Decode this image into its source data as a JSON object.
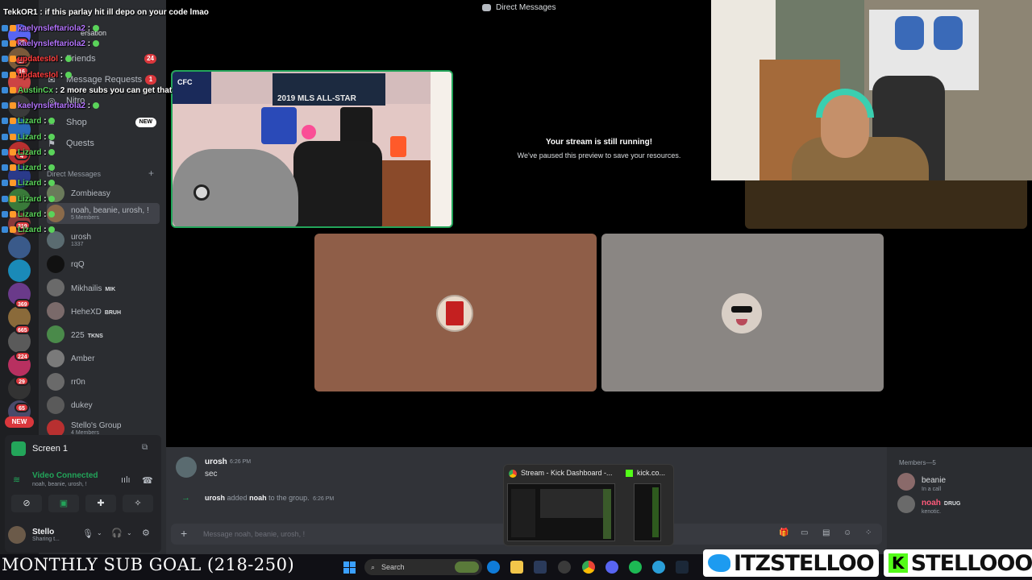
{
  "overlay_chat": [
    {
      "user": "TekkOR1",
      "color": "#ffffff",
      "text": "if this parlay hit ill depo on your code lmao"
    },
    {
      "user": "kaelynsleftariola2",
      "color": "#b575ff",
      "text": ""
    },
    {
      "user": "kaelynsleftariola2",
      "color": "#b575ff",
      "text": ""
    },
    {
      "user": "updatesIol",
      "color": "#ff3c3c",
      "text": ""
    },
    {
      "user": "updatesIol",
      "color": "#ff3c3c",
      "text": ""
    },
    {
      "user": "AustinCx",
      "color": "#5ad35a",
      "text": "2 more subs you can get that"
    },
    {
      "user": "kaelynsleftariola2",
      "color": "#b575ff",
      "text": ""
    },
    {
      "user": "Lizard",
      "color": "#5ad35a",
      "text": ""
    },
    {
      "user": "Lizard",
      "color": "#5ad35a",
      "text": ""
    },
    {
      "user": "Lizard",
      "color": "#5ad35a",
      "text": ""
    },
    {
      "user": "Lizard",
      "color": "#5ad35a",
      "text": ""
    },
    {
      "user": "Lizard",
      "color": "#5ad35a",
      "text": ""
    },
    {
      "user": "Lizard",
      "color": "#5ad35a",
      "text": ""
    },
    {
      "user": "Lizard",
      "color": "#5ad35a",
      "text": ""
    },
    {
      "user": "Lizard",
      "color": "#5ad35a",
      "text": ""
    }
  ],
  "server_badges": [
    "25",
    "18",
    "16",
    "4",
    "319",
    "369",
    "665",
    "224",
    "29",
    "65"
  ],
  "server_new": "NEW",
  "sidebar": {
    "items": [
      {
        "label": "Find or start a conversation",
        "visible_fragment": "ersation"
      },
      {
        "label": "Friends",
        "badge": "24"
      },
      {
        "label": "Message Requests",
        "badge": "1"
      },
      {
        "label": "Nitro"
      },
      {
        "label": "Shop",
        "badge_new": "NEW"
      },
      {
        "label": "Quests"
      }
    ],
    "dm_header": "Direct Messages",
    "dm_plus": "+",
    "dms": [
      {
        "name": "Zombieasy",
        "sub": "",
        "tag": "",
        "color": "#6a7a5a"
      },
      {
        "name": "noah, beanie, urosh, !",
        "sub": "5 Members",
        "tag": "",
        "color": "#8a6a4a"
      },
      {
        "name": "urosh",
        "sub": "1337",
        "tag": "",
        "color": "#5a6b70"
      },
      {
        "name": "rqQ",
        "sub": "",
        "tag": "",
        "color": "#111111"
      },
      {
        "name": "Mikhailis",
        "sub": "",
        "tag": "MIK",
        "color": "#6a6a6a"
      },
      {
        "name": "HeheXD",
        "sub": "",
        "tag": "BRUH",
        "color": "#7a6a6a"
      },
      {
        "name": "225",
        "sub": "",
        "tag": "TKNS",
        "color": "#4a8a4a"
      },
      {
        "name": "Amber",
        "sub": "",
        "tag": "",
        "color": "#7a7a7a"
      },
      {
        "name": "rr0n",
        "sub": "",
        "tag": "",
        "color": "#6a6a6a"
      },
      {
        "name": "dukey",
        "sub": "",
        "tag": "",
        "color": "#5a5a5a"
      },
      {
        "name": "Stello's Group",
        "sub": "4 Members",
        "tag": "",
        "color": "#b83030"
      }
    ]
  },
  "voice": {
    "screen_label": "Screen 1",
    "status": "Video Connected",
    "status_sub": "noah, beanie, urosh, !"
  },
  "user_panel": {
    "name": "Stello",
    "status": "Sharing t..."
  },
  "main": {
    "title": "Direct Messages",
    "paused_title": "Your stream is still running!",
    "paused_sub": "We've paused this preview to save your resources."
  },
  "chat": {
    "message": {
      "author": "urosh",
      "time": "6:26 PM",
      "text": "sec"
    },
    "system": {
      "actor": "urosh",
      "verb": "added",
      "target": "noah",
      "rest": "to the group.",
      "time": "6:26 PM"
    },
    "placeholder": "Message noah, beanie, urosh, !"
  },
  "members": {
    "header": "Members—5",
    "list": [
      {
        "name": "beanie",
        "sub": "In a call",
        "tag": "",
        "color": "#8a6a6a"
      },
      {
        "name": "noah",
        "sub": "kenotic.",
        "tag": "DRUG",
        "color": "#6a6a6a"
      }
    ]
  },
  "popup": {
    "title1": "Stream - Kick Dashboard -...",
    "title2": "kick.co..."
  },
  "bottom": {
    "sub_goal": "MONTHLY SUB GOAL (218-250)",
    "search": "Search",
    "twitter": "ITZSTELLOO",
    "kick": "STELLOOO"
  },
  "colors": {
    "accent_green": "#23a55a",
    "danger_red": "#da373c",
    "kick_green": "#53fc18",
    "twitter_blue": "#1d9bf0"
  }
}
